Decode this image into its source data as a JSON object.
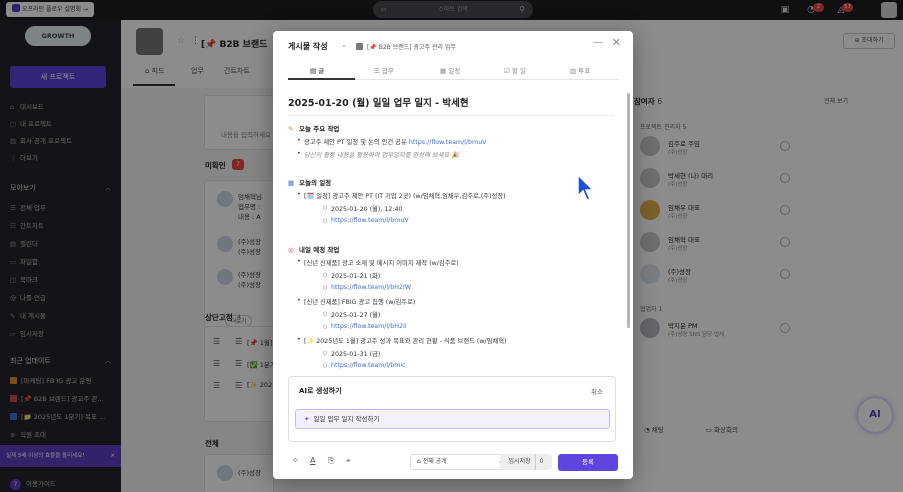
{
  "topbar": {
    "intro_button": "오프라인 플로우 설명회 →",
    "search_placeholder": "스마트 검색",
    "notif_badge_1": "2",
    "notif_badge_2": "57"
  },
  "sidebar": {
    "logo": "GROWTH",
    "new_project": "새 프로젝트",
    "nav": [
      {
        "label": "대시보드",
        "icon": "home-icon"
      },
      {
        "label": "내 프로젝트",
        "icon": "folder-icon"
      },
      {
        "label": "회사 공개 프로젝트",
        "icon": "building-icon"
      },
      {
        "label": "더보기",
        "icon": "more-icon"
      }
    ],
    "browse_header": "모아보기",
    "browse": [
      {
        "label": "전체 업무",
        "icon": "list-icon"
      },
      {
        "label": "간트차트",
        "icon": "gantt-icon"
      },
      {
        "label": "캘린더",
        "icon": "calendar-icon"
      },
      {
        "label": "파일함",
        "icon": "file-icon"
      },
      {
        "label": "북마크",
        "icon": "bookmark-icon"
      },
      {
        "label": "나를 언급",
        "icon": "at-icon"
      },
      {
        "label": "내 게시물",
        "icon": "post-icon"
      },
      {
        "label": "임시저장",
        "icon": "draft-icon"
      }
    ],
    "recent_header": "최근 업데이트",
    "recent": [
      {
        "label": "[마케팅] FB IG 광고 운영",
        "color": "#e0922f"
      },
      {
        "label": "[📌 B2B 브랜드] 광고주 관...",
        "color": "#d64545"
      },
      {
        "label": "[📁 2025년도 1분기] 목표 ...",
        "color": "#3d6fd6"
      }
    ],
    "invite": "직원 초대",
    "promo": "실제 5배 이상의 효율을 올리세요!",
    "guide": "이용가이드"
  },
  "main": {
    "project_title": "[📌 B2B 브랜드",
    "invite_button": "초대하기",
    "tabs": [
      "피드",
      "업무",
      "간트차트"
    ],
    "placeholder_text": "내용을 입력하세요",
    "unread_label": "미확인",
    "unread_count": "7",
    "feed_rows": [
      {
        "title": "임채혁님",
        "line1": "업무명 :",
        "line2": "내용 : A"
      },
      {
        "title": "(주)성장",
        "line1": "(주)성장",
        "line2": ""
      },
      {
        "title": "(주)성장",
        "line1": "(주)성장",
        "line2": ""
      }
    ],
    "more_button": "더보기",
    "pinned_label": "상단고정",
    "pinned_count": "4",
    "pinned": [
      "[📌 1월]",
      "[✅ 1분기]",
      "[✨ 202"
    ],
    "all_label": "전체",
    "all_row": "(주)성장"
  },
  "participants": {
    "title": "참여자",
    "count": "6",
    "view_all": "전체 보기",
    "admin_section": "프로젝트 관리자 5",
    "admins": [
      {
        "name": "김주로 주임",
        "company": "(주)성장"
      },
      {
        "name": "박세현 (나) 대리",
        "company": "(주)성장"
      },
      {
        "name": "임채우 대표",
        "company": "(주)성장"
      },
      {
        "name": "임채혁 대표",
        "company": "(주)성장"
      },
      {
        "name": "(주)성장",
        "company": "(주)성장"
      }
    ],
    "outside_section": "협업자 1",
    "outside": [
      {
        "name": "박지윤 PM",
        "company": "(주)성장 SNS 담당 업체"
      }
    ],
    "chat_button": "채팅",
    "video_button": "화상회의"
  },
  "modal": {
    "title": "게시물 작성",
    "project": "[📌 B2B 브랜드] 광고주 관리 업무",
    "tabs": [
      {
        "label": "글",
        "icon": "doc-icon"
      },
      {
        "label": "업무",
        "icon": "task-icon"
      },
      {
        "label": "일정",
        "icon": "calendar-icon"
      },
      {
        "label": "할 일",
        "icon": "checkbox-icon"
      },
      {
        "label": "투표",
        "icon": "vote-icon"
      }
    ],
    "post_title": "2025-01-20 (월) 일일 업무 일지 - 박세현",
    "sections": {
      "today_head": "오늘 주요 작업",
      "today_1_text": "광고주 제안 PT 일정 및 논의 안건 공유 ",
      "today_1_link": "https://flow.team/l/bmuV",
      "today_2_hint": "당신의 활동 내용을 활용하여 업무일지를 완성해 보세요 🎉",
      "schedule_head": "오늘의 일정",
      "schedule_1": "[🗓️ 일정] 광고주 제안 PT (IT 기업 2곳) (w/임채혁,임채우,김주로,(주)성장)",
      "schedule_1_date": "2025-01-20 (월), 12:40",
      "schedule_1_link": "https://flow.team/l/bmuV",
      "plan_head": "내일 예정 작업",
      "plan_1": "[신년 신제품] 광고 소재 및 메시지 이미지 제작 (w/김주로)",
      "plan_1_date": "2025-01-21 (화)",
      "plan_1_link": "https://flow.team/l/bH2IW",
      "plan_2": "[신년 신제품] FBIG 광고 집행 (w/김주로)",
      "plan_2_date": "2025-01-27 (월)",
      "plan_2_link": "https://flow.team/l/bH2Ii",
      "plan_3": "[✨ 2025년도 1월] 광고주 성과 목표와 관리 현황 - 식품 브랜드 (w/임채혁)",
      "plan_3_date": "2025-01-31 (금)",
      "plan_3_link": "https://flow.team/l/bmic"
    },
    "ai": {
      "title": "AI로 생성하기",
      "cancel": "취소",
      "suggestion": "일일 업무 일지 작성하기"
    },
    "footer": {
      "visibility": "전체 공개",
      "temp_save": "임시저장",
      "temp_count": "0",
      "submit": "등록"
    }
  },
  "ai_fab": "AI"
}
